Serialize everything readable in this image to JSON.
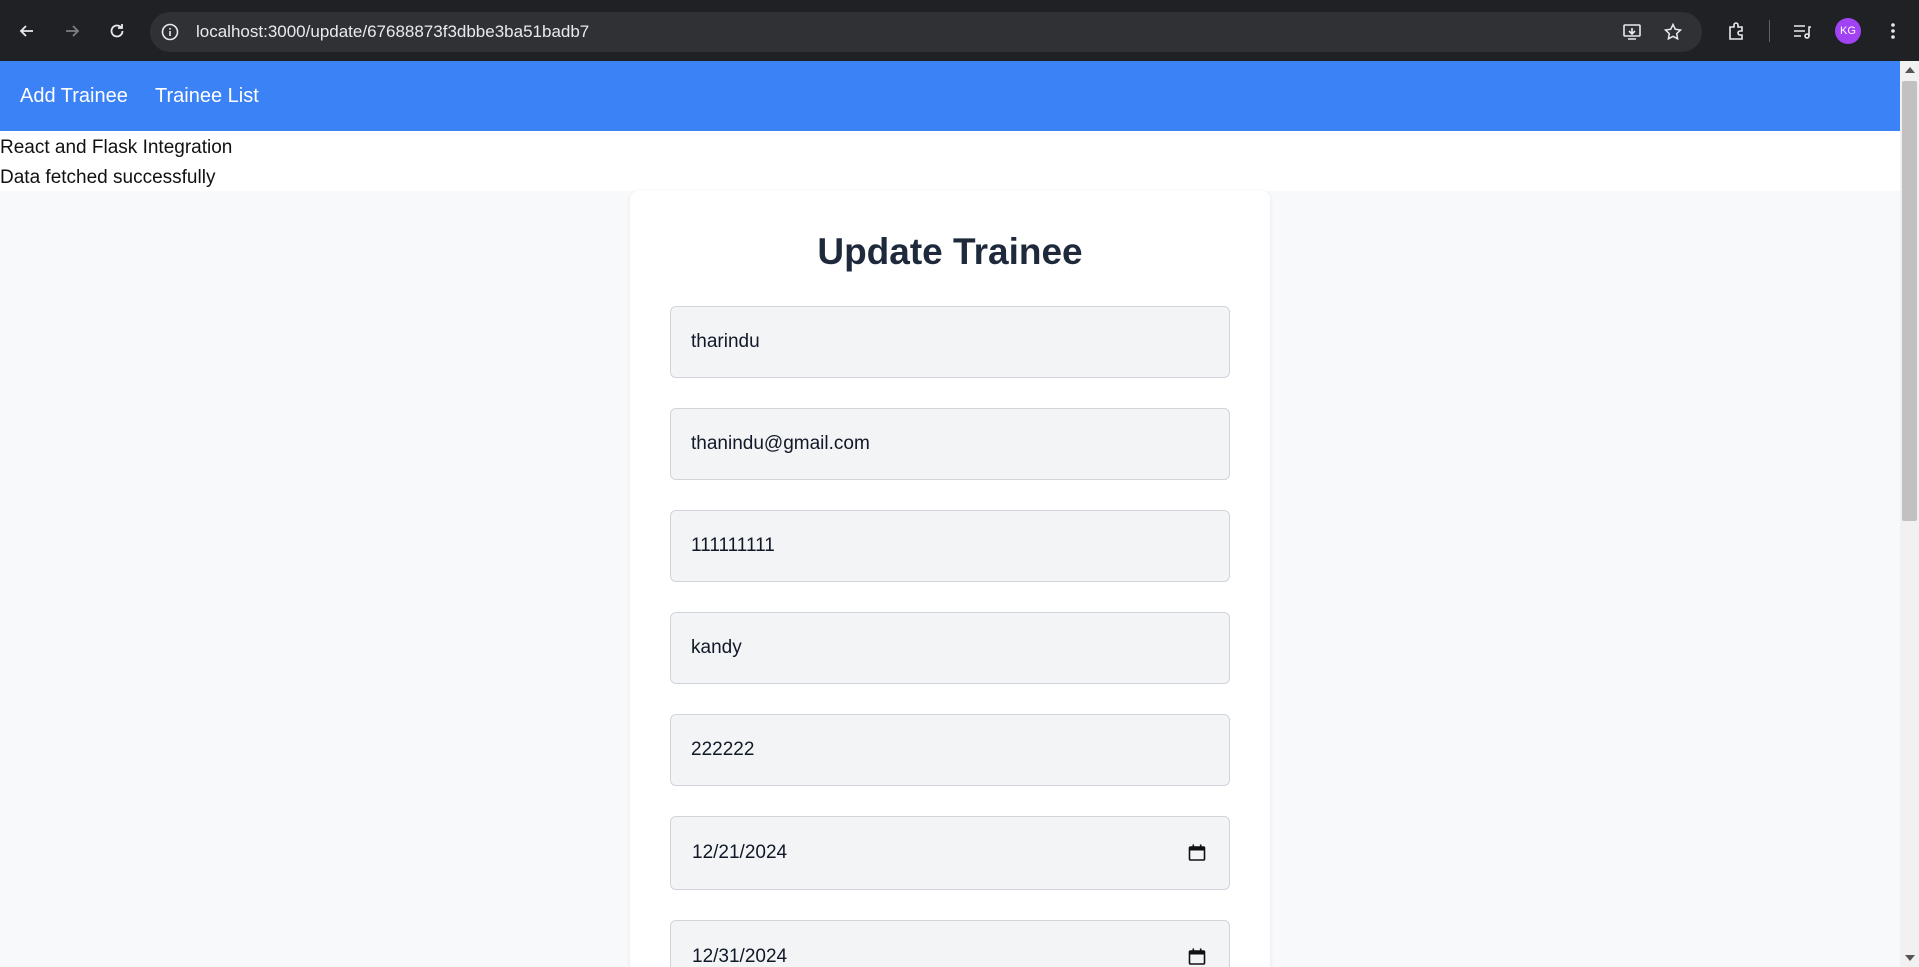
{
  "browser": {
    "url": "localhost:3000/update/67688873f3dbbe3ba51badb7",
    "profile_initials": "KG"
  },
  "navbar": {
    "links": [
      "Add Trainee",
      "Trainee List"
    ]
  },
  "status": {
    "app_name": "React and Flask Integration",
    "message": "Data fetched successfully"
  },
  "form": {
    "title": "Update Trainee",
    "fields": {
      "name": "tharindu",
      "email": "thanindu@gmail.com",
      "phone": "111111111",
      "address": "kandy",
      "code": "222222",
      "start_date": "12/21/2024",
      "end_date": "12/31/2024"
    }
  },
  "colors": {
    "navbar": "#3b82f6",
    "title": "#1e293b",
    "input_bg": "#f3f4f6"
  }
}
